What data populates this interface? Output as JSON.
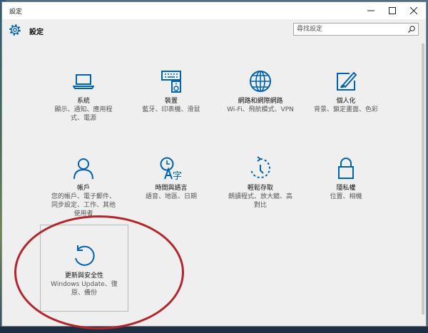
{
  "window": {
    "title": "設定"
  },
  "header": {
    "title": "設定",
    "search_placeholder": "尋找設定"
  },
  "tiles": [
    {
      "name": "系統",
      "desc": "顯示、通知、應用程式、電源",
      "icon": "laptop-icon"
    },
    {
      "name": "裝置",
      "desc": "藍牙、印表機、滑鼠",
      "icon": "keyboard-speaker-icon"
    },
    {
      "name": "網路和網際網路",
      "desc": "Wi-Fi、飛航模式、VPN",
      "icon": "globe-icon"
    },
    {
      "name": "個人化",
      "desc": "背景、鎖定畫面、色彩",
      "icon": "paint-brush-icon"
    },
    {
      "name": "帳戶",
      "desc": "您的帳戶、電子郵件、同步設定、工作、其他使用者",
      "icon": "person-icon"
    },
    {
      "name": "時間與語言",
      "desc": "語音、地區、日期",
      "icon": "time-language-icon"
    },
    {
      "name": "輕鬆存取",
      "desc": "朗讀程式、放大鏡、高對比",
      "icon": "ease-of-access-icon"
    },
    {
      "name": "隱私權",
      "desc": "位置、相機",
      "icon": "lock-icon"
    },
    {
      "name": "更新與安全性",
      "desc": "Windows Update、復原、備份",
      "icon": "update-icon"
    }
  ],
  "colors": {
    "accent": "#0063b1",
    "highlight": "#b3262d"
  }
}
